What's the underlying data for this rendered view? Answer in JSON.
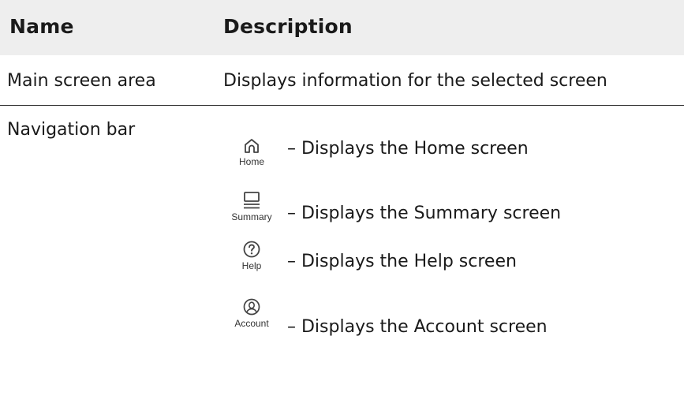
{
  "table": {
    "headers": {
      "name": "Name",
      "description": "Description"
    },
    "rows": [
      {
        "name": "Main screen area",
        "description": "Displays information for the selected screen"
      },
      {
        "name": "Navigation bar",
        "items": [
          {
            "icon": "home-icon",
            "label": "Home",
            "description": "– Displays the Home screen"
          },
          {
            "icon": "summary-icon",
            "label": "Summary",
            "description": "– Displays the Summary screen"
          },
          {
            "icon": "help-icon",
            "label": "Help",
            "description": "– Displays the Help screen"
          },
          {
            "icon": "account-icon",
            "label": "Account",
            "description": "– Displays the Account screen"
          }
        ]
      }
    ]
  }
}
